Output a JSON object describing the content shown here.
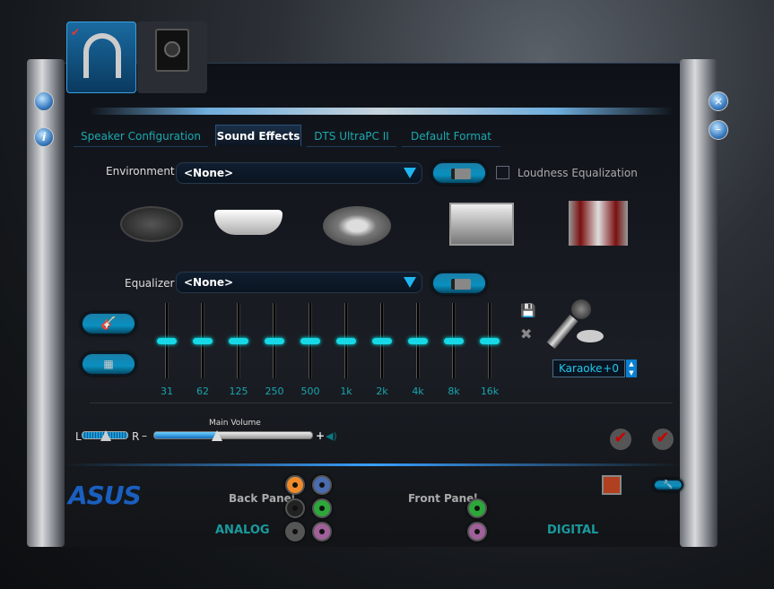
{
  "device_tabs": [
    {
      "name": "headphones",
      "selected": true
    },
    {
      "name": "speaker",
      "selected": false
    }
  ],
  "tabs": [
    {
      "label": "Speaker Configuration"
    },
    {
      "label": "Sound Effects",
      "active": true
    },
    {
      "label": "DTS UltraPC II"
    },
    {
      "label": "Default Format"
    }
  ],
  "environment": {
    "label": "Environment",
    "value": "<None>",
    "loudness_label": "Loudness Equalization",
    "loudness_checked": false
  },
  "environment_presets": [
    "stone-floor-icon",
    "bathtub-icon",
    "stadium-icon",
    "room-icon",
    "theater-icon"
  ],
  "equalizer": {
    "label": "Equalizer",
    "value": "<None>",
    "bands": [
      {
        "freq": "31",
        "level": 0
      },
      {
        "freq": "62",
        "level": 0
      },
      {
        "freq": "125",
        "level": 0
      },
      {
        "freq": "250",
        "level": 0
      },
      {
        "freq": "500",
        "level": 0
      },
      {
        "freq": "1k",
        "level": 0
      },
      {
        "freq": "2k",
        "level": 0
      },
      {
        "freq": "4k",
        "level": 0
      },
      {
        "freq": "8k",
        "level": 0
      },
      {
        "freq": "16k",
        "level": 0
      }
    ]
  },
  "karaoke": {
    "label": "Karaoke",
    "value": "+0"
  },
  "volume": {
    "title": "Main Volume",
    "left": "L",
    "right": "R",
    "minus": "–",
    "plus": "+",
    "balance": 0.5,
    "level": 0.4
  },
  "bottom": {
    "back_panel": "Back Panel",
    "front_panel": "Front Panel",
    "analog": "ANALOG",
    "digital": "DIGITAL",
    "brand": "ASUS"
  },
  "colors": {
    "accent": "#1fb6f0",
    "teal": "#19a6ad"
  },
  "back_jacks": [
    "#f08a2a",
    "#4a6cb0",
    "#222222",
    "#2ca83a",
    "#555555",
    "#a0609a"
  ],
  "front_jacks": [
    "#2ca83a",
    "#a0609a"
  ]
}
